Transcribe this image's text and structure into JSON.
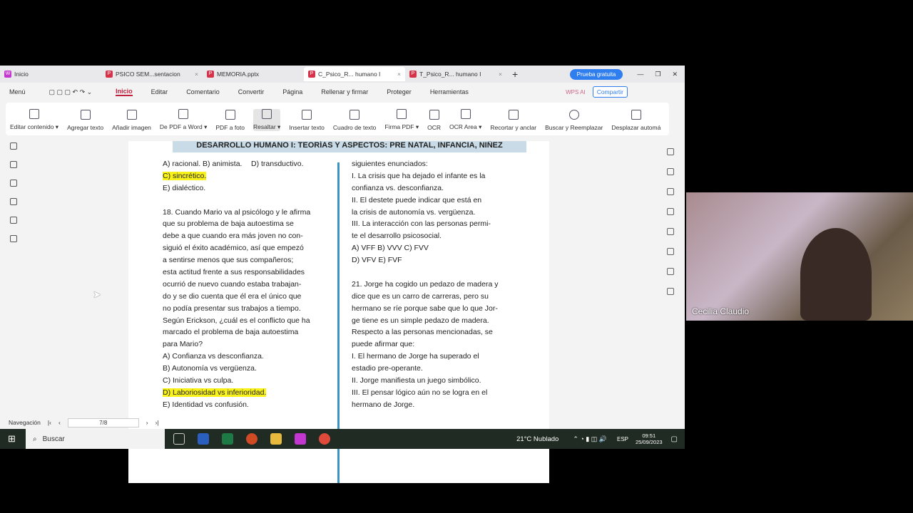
{
  "tabs": [
    {
      "label": "Inicio"
    },
    {
      "label": "PSICO SEM...sentacion"
    },
    {
      "label": "MEMORIA.pptx"
    },
    {
      "label": "C_Psico_R... humano I"
    },
    {
      "label": "T_Psico_R... humano I"
    }
  ],
  "top_buttons": {
    "prueba": "Prueba gratuita",
    "compartir": "Compartir",
    "wps_ai": "WPS AI"
  },
  "menu": [
    "Inicio",
    "Editar",
    "Comentario",
    "Convertir",
    "Página",
    "Rellenar y firmar",
    "Proteger",
    "Herramientas"
  ],
  "menu_label": "Menú",
  "ribbon": [
    "Editar contenido ▾",
    "Agregar texto",
    "Añadir imagen",
    "De PDF a Word ▾",
    "PDF a foto",
    "Resaltar ▾",
    "Insertar texto",
    "Cuadro de texto",
    "Firma PDF ▾",
    "OCR",
    "OCR Area ▾",
    "Recortar y anclar",
    "Buscar y Reemplazar",
    "Desplazar automá"
  ],
  "doc": {
    "banner": "DESARROLLO HUMANO I: TEORÍAS Y ASPECTOS: PRE NATAL, INFANCIA, NIÑEZ",
    "left": [
      "A)  racional.            B)  animista.",
      "C)  sincrético.",
      "E)  dialéctico.",
      "",
      "18. Cuando Mario va al psicólogo y le afirma",
      "que su problema de baja autoestima se",
      "debe a que cuando era más joven no con-",
      "siguió el éxito académico, así que empezó",
      "a sentirse menos que sus compañeros;",
      "esta actitud frente a sus responsabilidades",
      "ocurrió de nuevo cuando estaba trabajan-",
      "do y se dio cuenta que él era el único que",
      "no podía presentar sus trabajos a tiempo.",
      "Según Erickson, ¿cuál es el conflicto que ha",
      "marcado el problema de baja autoestima",
      "para Mario?",
      "A)  Confianza vs desconfianza.",
      "B)  Autonomía vs vergüenza.",
      "C)  Iniciativa vs culpa.",
      "D)  Laboriosidad vs inferioridad.",
      "E)  Identidad vs confusión."
    ],
    "left_extra_d": "D)  transductivo.",
    "right": [
      "siguientes enunciados:",
      "I.    La crisis que ha dejado el infante es la",
      "       confianza vs. desconfianza.",
      "II.   El destete puede indicar que está en",
      "       la crisis de autonomía vs. vergüenza.",
      "III.  La interacción con las personas permi-",
      "       te el desarrollo psicosocial.",
      "A)  VFF          B)  VVV          C)  FVV",
      "D)  VFV          E)  FVF",
      "",
      "21. Jorge ha cogido un pedazo de madera y",
      "dice que es un carro de carreras, pero su",
      "hermano se ríe porque sabe que lo que Jor-",
      "ge tiene es un simple pedazo de madera.",
      "Respecto a las personas mencionadas, se",
      "puede afirmar que:",
      "I.    El hermano de Jorge ha superado el",
      "       estadio pre-operante.",
      "II.   Jorge manifiesta un juego simbólico.",
      "III.  El pensar lógico aún no se logra en el",
      "       hermano de Jorge."
    ]
  },
  "status": {
    "nav": "Navegación",
    "page": "7/8"
  },
  "taskbar": {
    "search": "Buscar",
    "weather": "21°C  Nublado",
    "lang": "ESP",
    "time": "09:51",
    "date": "25/09/2023"
  },
  "webcam": {
    "name": "Cecilia Claudio"
  }
}
